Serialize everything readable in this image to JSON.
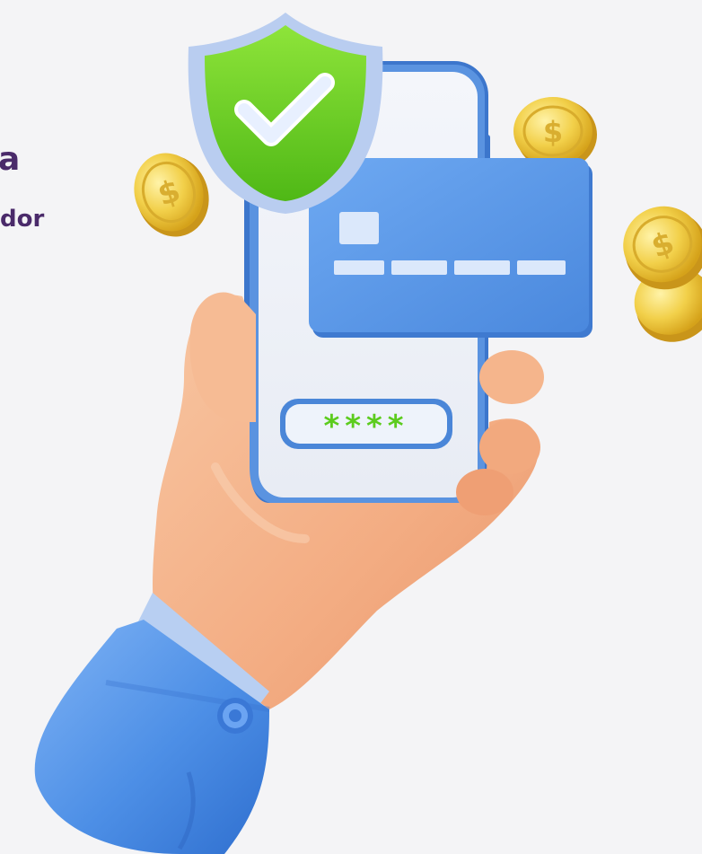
{
  "hero": {
    "heading_fragment": "a",
    "subheading_fragment": "dor",
    "pin_mask": "****"
  },
  "icons": {
    "shield": "shield-check-icon",
    "card": "credit-card-icon",
    "coin": "dollar-coin-icon"
  },
  "colors": {
    "text": "#4a2a6a",
    "background": "#f4f4f6",
    "phone_frame": "#4a86d8",
    "card": "#5a99ea",
    "shield_green": "#6ad21e",
    "pin_green": "#5ccc1e",
    "coin_gold": "#f0cc3a",
    "sleeve_blue": "#4d8fe6",
    "skin": "#f4b48c"
  }
}
